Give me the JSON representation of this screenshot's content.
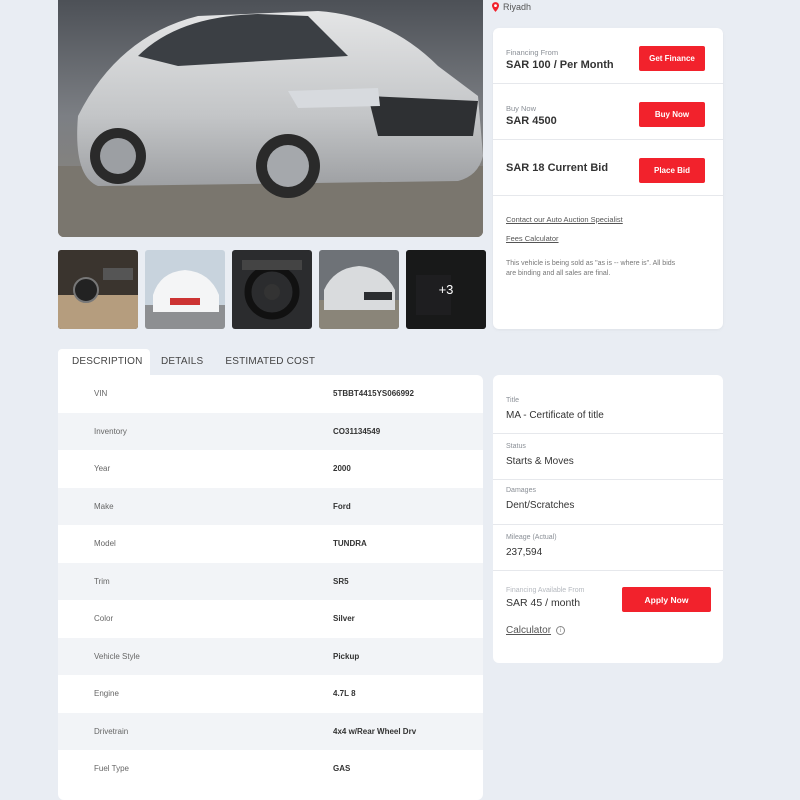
{
  "location": "Riyadh",
  "purchase": {
    "financing_label": "Financing From",
    "financing_value": "SAR 100 / Per Month",
    "get_finance_button": "Get Finance",
    "buy_now_label": "Buy Now",
    "buy_now_value": "SAR 4500",
    "buy_now_button": "Buy Now",
    "current_bid": "SAR 18 Current Bid",
    "place_bid_button": "Place Bid",
    "contact_link": "Contact our Auto  Auction Specialist",
    "fees_link": "Fees Calculator",
    "note": "This vehicle is being sold as \"as is -- where is\". All bids are binding and all sales are final."
  },
  "gallery": {
    "more_count": "+3"
  },
  "tabs": [
    "DESCRIPTION",
    "DETAILS",
    "ESTIMATED COST"
  ],
  "details": [
    {
      "label": "VIN",
      "value": "5TBBT4415YS066992"
    },
    {
      "label": "Inventory",
      "value": "CO31134549"
    },
    {
      "label": "Year",
      "value": "2000"
    },
    {
      "label": "Make",
      "value": "Ford"
    },
    {
      "label": "Model",
      "value": "TUNDRA"
    },
    {
      "label": "Trim",
      "value": "SR5"
    },
    {
      "label": "Color",
      "value": "Silver"
    },
    {
      "label": "Vehicle Style",
      "value": "Pickup"
    },
    {
      "label": "Engine",
      "value": "4.7L 8"
    },
    {
      "label": "Drivetrain",
      "value": "4x4 w/Rear Wheel Drv"
    },
    {
      "label": "Fuel Type",
      "value": "GAS"
    }
  ],
  "info": [
    {
      "label": "Title",
      "value": "MA - Certificate of title"
    },
    {
      "label": "Status",
      "value": "Starts & Moves"
    },
    {
      "label": "Damages",
      "value": "Dent/Scratches"
    },
    {
      "label": "Mileage (Actual)",
      "value": "237,594"
    }
  ],
  "finance": {
    "label": "Financing Available From",
    "value": "SAR 45 / month",
    "apply_button": "Apply Now",
    "calculator_link": "Calculator",
    "info_glyph": "i"
  },
  "colors": {
    "accent": "#f2222c",
    "background": "#e9edf3"
  }
}
